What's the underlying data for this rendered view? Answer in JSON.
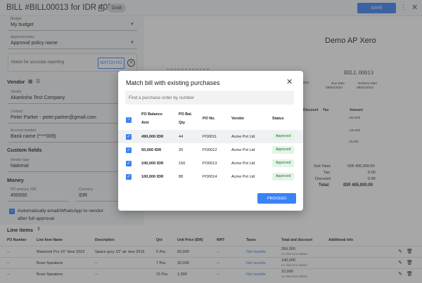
{
  "header": {
    "title": "BILL #BILL00013 for IDR 40550",
    "status": "Draft",
    "save_label": "SAVE",
    "more": "⋮",
    "close": "✕"
  },
  "form": {
    "budget": {
      "label": "Budget",
      "value": "My budget"
    },
    "approval": {
      "label": "Approval policy",
      "value": "Approval policy name"
    },
    "match_text": "Match for accurate reporting",
    "match_button": "MATCH PO",
    "vendor_section": "Vendor",
    "vendor": {
      "label": "Vendor",
      "value": "Akanksha Test Company"
    },
    "contact": {
      "label": "Contact",
      "value": "Peter Parker - peter.parker@gmail.com"
    },
    "account": {
      "label": "Account number",
      "value": "Bank name (****009)"
    },
    "custom_section": "Custom fields",
    "vendor_type": {
      "label": "Vendor type",
      "value": "National"
    },
    "money_section": "Money",
    "po_amount": {
      "label": "PO amount, IDR",
      "value": "490000"
    },
    "currency": {
      "label": "Currency",
      "value": "IDR"
    },
    "auto_email": "Automatically email/WhatsApp to vendor",
    "auto_email_2": "after full approval"
  },
  "document": {
    "company": "Demo AP Xero",
    "bill_no": "BILL 00013",
    "col_date_left": "023",
    "due_date": {
      "label": "Due Date",
      "value": "08/02/2023"
    },
    "delivery_date": {
      "label": "Delivery Date",
      "value": "08/02/2023"
    },
    "headers": {
      "discount": "Discount",
      "tax": "Tax",
      "amount": "Amount"
    },
    "amounts": [
      "250,000",
      "140,000",
      "15,000"
    ],
    "totals": [
      {
        "label": "Sub Total:",
        "value": "IDR 405,000.00"
      },
      {
        "label": "Tax:",
        "value": "0.00"
      },
      {
        "label": "Discount:",
        "value": "0.00"
      },
      {
        "label": "Total:",
        "value": "IDR 405,000.00"
      }
    ]
  },
  "modal": {
    "title": "Match bill with existing purchases",
    "search_placeholder": "Find a purchase order by number",
    "columns": {
      "balance_1": "PO Balance",
      "balance_2": "Amt",
      "qty_1": "PO Bal.",
      "qty_2": "Qty",
      "po_no": "PO No.",
      "vendor": "Vendor",
      "status": "Status"
    },
    "rows": [
      {
        "amount": "490,000 IDR",
        "qty": "44",
        "po": "PO0011",
        "vendor": "Acme Pvt Ltd",
        "status": "Approved"
      },
      {
        "amount": "50,000 IDR",
        "qty": "20",
        "po": "PO0012",
        "vendor": "Acme Pvt Ltd",
        "status": "Approved"
      },
      {
        "amount": "240,000 IDR",
        "qty": "150",
        "po": "PO0013",
        "vendor": "Acme Pvt Ltd",
        "status": "Approved"
      },
      {
        "amount": "100,000 IDR",
        "qty": "88",
        "po": "PO0014",
        "vendor": "Acme Pvt Ltd",
        "status": "Approved"
      }
    ],
    "proceed": "PROCEED"
  },
  "line_items": {
    "title": "Line items",
    "headers": [
      "PO Number",
      "Line Item Name",
      "Description",
      "Qnt",
      "Unit Price (IDR)",
      "WHT",
      "Taxes",
      "Total and discount",
      "Additional info"
    ],
    "rows": [
      {
        "po": "--",
        "name": "Macbook Pro 16\" New 2023",
        "desc": "Space grey 15\" air new 2016",
        "qnt": "5 Psc",
        "price": "50,000",
        "wht": "--",
        "taxes": "Not taxable",
        "total": "250,000",
        "discount": "no discount added"
      },
      {
        "po": "--",
        "name": "Bose Speakers",
        "desc": "--",
        "qnt": "7 Psc",
        "price": "20,000",
        "wht": "--",
        "taxes": "Not taxable",
        "total": "140,000",
        "discount": "no discount added"
      },
      {
        "po": "--",
        "name": "Bose Speakers",
        "desc": "--",
        "qnt": "15 Psc",
        "price": "1,000",
        "wht": "--",
        "taxes": "Not taxable",
        "total": "15,000",
        "discount": "no discount added"
      }
    ]
  }
}
